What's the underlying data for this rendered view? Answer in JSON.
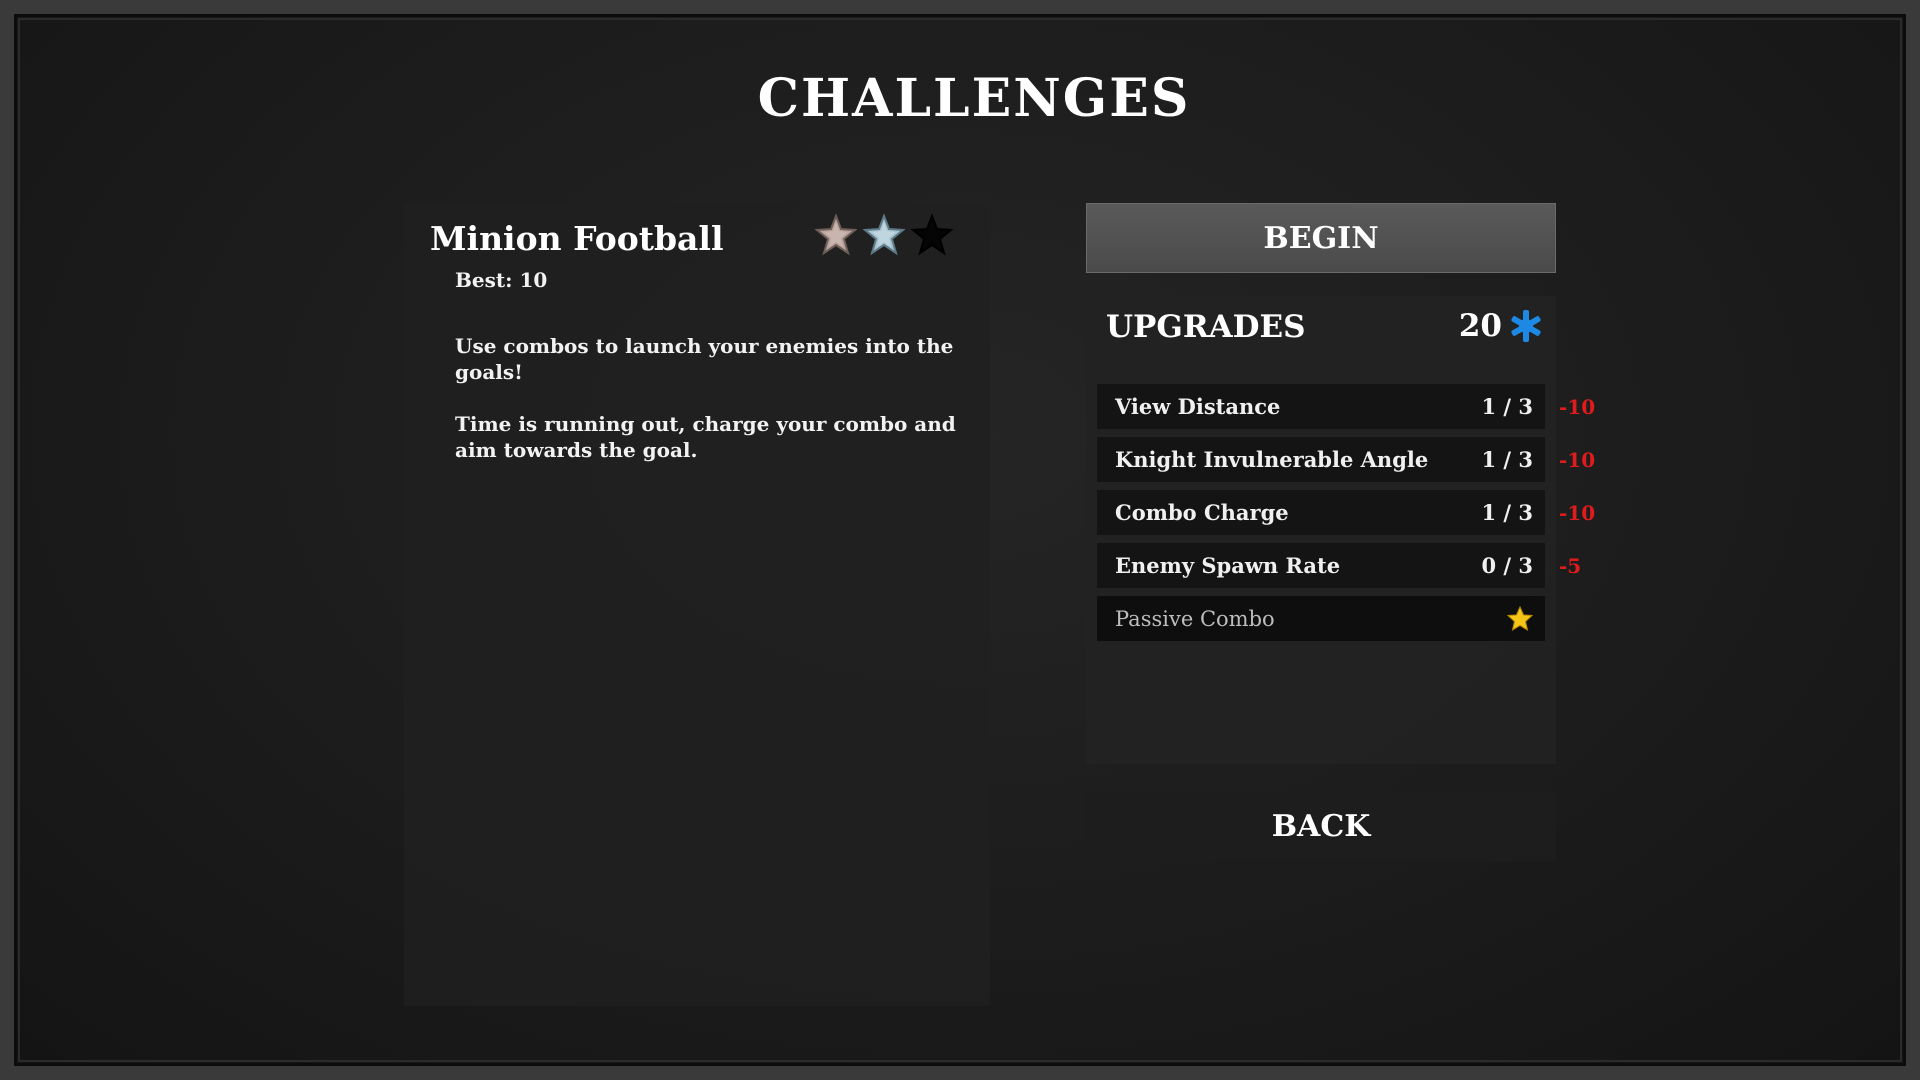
{
  "screen": {
    "title": "CHALLENGES"
  },
  "challenge": {
    "name": "Minion Football",
    "best_label": "Best:",
    "best_value": "10",
    "description": [
      "Use combos to launch your enemies into the goals!",
      "Time is running out, charge your combo and aim towards the goal."
    ],
    "stars": [
      {
        "icon": "bronze-star-icon",
        "color": "#b9a39c",
        "earned": true
      },
      {
        "icon": "silver-star-icon",
        "color": "#a9c4d1",
        "earned": true
      },
      {
        "icon": "gold-star-icon",
        "color": "#050505",
        "earned": false
      }
    ]
  },
  "actions": {
    "begin_label": "BEGIN",
    "back_label": "BACK"
  },
  "upgrades": {
    "title": "UPGRADES",
    "points": "20",
    "points_icon": "blue-asterisk-star-icon",
    "points_color": "#1e88e5",
    "items": [
      {
        "name": "View Distance",
        "level": "1 / 3",
        "cost": "-10"
      },
      {
        "name": "Knight Invulnerable Angle",
        "level": "1 / 3",
        "cost": "-10"
      },
      {
        "name": "Combo Charge",
        "level": "1 / 3",
        "cost": "-10"
      },
      {
        "name": "Enemy Spawn Rate",
        "level": "0 / 3",
        "cost": "-5"
      }
    ],
    "passive": {
      "name": "Passive Combo",
      "icon": "gold-star-icon",
      "color": "#f5c518"
    }
  }
}
